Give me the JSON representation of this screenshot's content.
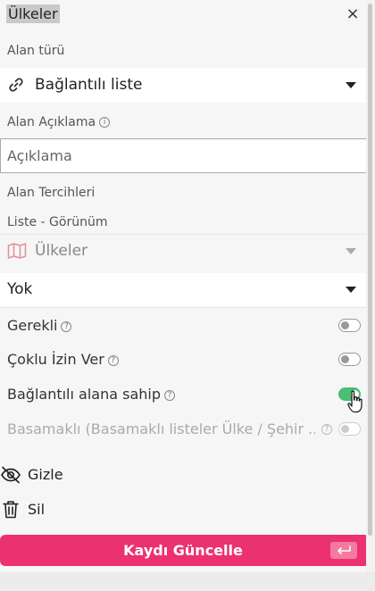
{
  "header": {
    "title": "Ülkeler",
    "close_icon": "×"
  },
  "field_type": {
    "label": "Alan türü",
    "value": "Bağlantılı liste",
    "icon": "link-icon"
  },
  "description": {
    "label": "Alan Açıklama",
    "info": "i",
    "placeholder": "Açıklama",
    "value": ""
  },
  "preferences": {
    "label": "Alan Tercihleri",
    "list_view_label": "Liste - Görünüm",
    "list_select": {
      "value": "Ülkeler",
      "icon": "map-icon"
    },
    "view_select": {
      "value": "Yok"
    }
  },
  "toggles": [
    {
      "label": "Gerekli",
      "info": "?",
      "on": false,
      "disabled": false
    },
    {
      "label": "Çoklu İzin Ver",
      "info": "?",
      "on": false,
      "disabled": false
    },
    {
      "label": "Bağlantılı alana sahip",
      "info": "?",
      "on": true,
      "disabled": false
    },
    {
      "label": "Basamaklı (Basamaklı listeler Ülke / Şehir ...",
      "info": "?",
      "on": false,
      "disabled": true
    }
  ],
  "actions": {
    "hide": {
      "label": "Gizle",
      "icon": "eye-slash-icon"
    },
    "delete": {
      "label": "Sil",
      "icon": "trash-icon"
    }
  },
  "save_button": {
    "label": "Kaydı Güncelle",
    "icon": "enter-key-icon"
  },
  "colors": {
    "accent": "#ec3170",
    "toggle_on": "#4bbf73",
    "muted_icon": "#e0909c"
  }
}
